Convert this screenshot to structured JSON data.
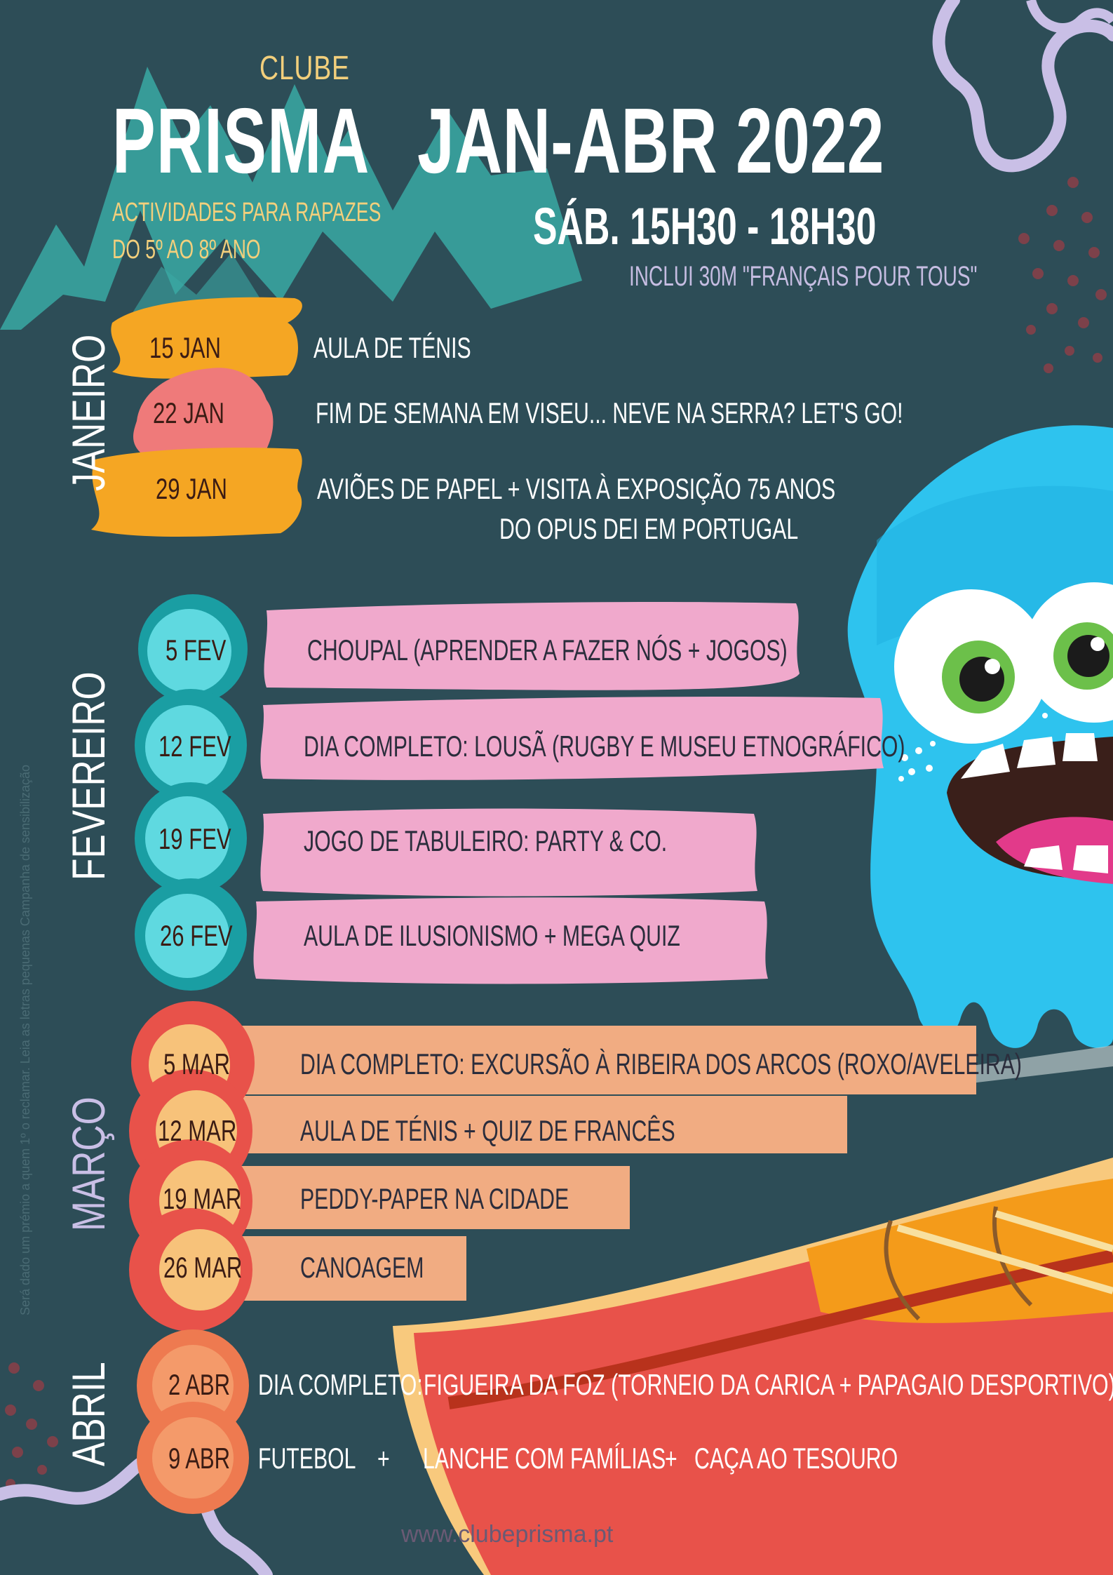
{
  "header": {
    "clube": "CLUBE",
    "prisma": "PRISMA",
    "subtitle_line1": "ACTIVIDADES PARA RAPAZES",
    "subtitle_line2": "DO 5º AO 8º ANO",
    "period": "JAN-ABR 2022",
    "time": "SÁB. 15H30 - 18H30",
    "note": "INCLUI 30M \"FRANÇAIS POUR TOUS\""
  },
  "side_note": "Será dado um prémio a quem 1º o reclamar. Leia as letras pequenas Campanha de sensibilização",
  "months": {
    "jan": "JANEIRO",
    "fev": "FEVEREIRO",
    "mar": "MARÇO",
    "abr": "ABRIL"
  },
  "january": [
    {
      "date": "15 JAN",
      "activity": "AULA DE TÉNIS"
    },
    {
      "date": "22 JAN",
      "activity": "FIM DE SEMANA EM VISEU... NEVE NA SERRA? LET'S GO!"
    },
    {
      "date": "29 JAN",
      "activity": "AVIÕES DE PAPEL  +  VISITA À EXPOSIÇÃO 75 ANOS",
      "activity_line2": "DO OPUS DEI EM PORTUGAL"
    }
  ],
  "february": [
    {
      "date": "5 FEV",
      "activity": "CHOUPAL (APRENDER A FAZER NÓS + JOGOS)"
    },
    {
      "date": "12 FEV",
      "activity": "DIA COMPLETO: LOUSÃ (RUGBY E MUSEU ETNOGRÁFICO)"
    },
    {
      "date": "19 FEV",
      "activity": "JOGO DE TABULEIRO: PARTY & CO."
    },
    {
      "date": "26 FEV",
      "activity": "AULA DE ILUSIONISMO + MEGA QUIZ"
    }
  ],
  "march": [
    {
      "date": "5 MAR",
      "activity": "DIA COMPLETO: EXCURSÃO À RIBEIRA DOS ARCOS (ROXO/AVELEIRA)"
    },
    {
      "date": "12 MAR",
      "activity": "AULA DE TÉNIS + QUIZ DE FRANCÊS"
    },
    {
      "date": "19 MAR",
      "activity": "PEDDY-PAPER NA CIDADE"
    },
    {
      "date": "26 MAR",
      "activity": "CANOAGEM"
    }
  ],
  "april": [
    {
      "date": "2 ABR",
      "label": "DIA COMPLETO:",
      "activity": "FIGUEIRA DA FOZ (TORNEIO DA CARICA + PAPAGAIO DESPORTIVO)"
    },
    {
      "date": "9 ABR",
      "part1": "FUTEBOL",
      "plus1": "+",
      "part2": "LANCHE COM FAMÍLIAS",
      "plus2": "+",
      "part3": "CAÇA AO TESOURO"
    }
  ],
  "footer": {
    "url": "www.clubeprisma.pt"
  },
  "colors": {
    "background": "#2d4d57",
    "mountain": "#3aa9a3",
    "jan_marker": "#f5a623",
    "jan_marker_alt": "#ef7a7a",
    "fev_circle": "#1a9ea3",
    "fev_circle_inner": "#5fd9e0",
    "fev_paper": "#f0a9cc",
    "mar_circle": "#e8524a",
    "mar_circle_inner": "#f7c27a",
    "mar_bar": "#f1ac82",
    "abr_circle": "#ee7a50",
    "monster": "#2ec3ee",
    "canoe": "#e8524a"
  }
}
